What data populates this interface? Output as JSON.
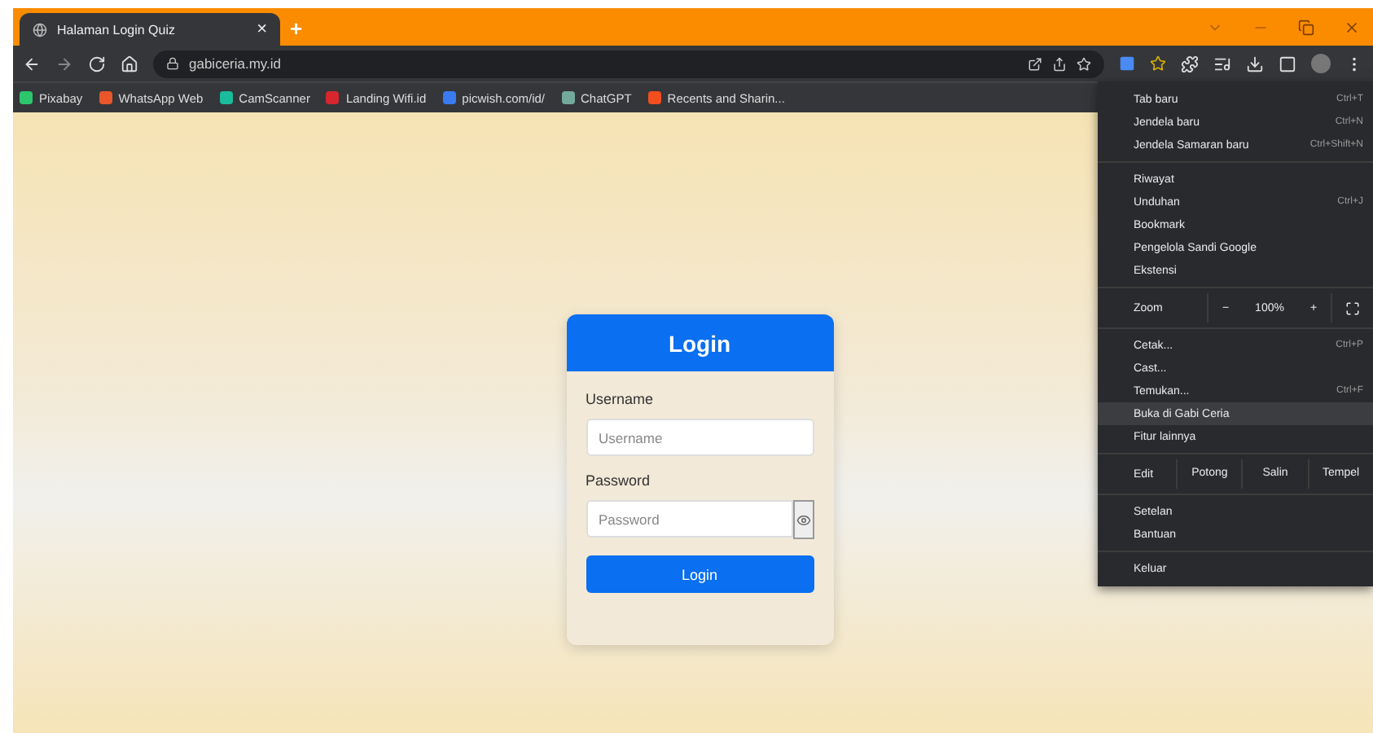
{
  "browser": {
    "tabs": [
      {
        "title": "Halaman Login Quiz",
        "close": "×",
        "selected": true
      }
    ],
    "new_tab": "+",
    "address": "gabiceria.my.id",
    "bookmarks": [
      {
        "label": "Pixabay",
        "color": "#2ec66d"
      },
      {
        "label": "WhatsApp Web",
        "color": "#e8562a"
      },
      {
        "label": "CamScanner",
        "color": "#19bc9c"
      },
      {
        "label": "Landing Wifi.id",
        "color": "#d8262e"
      },
      {
        "label": "picwish.com/id/",
        "color": "#3a7bf0"
      },
      {
        "label": "ChatGPT",
        "color": "#74aa9c"
      },
      {
        "label": "Recents and Sharin...",
        "color": "#f24e1e"
      }
    ]
  },
  "menu": {
    "items": [
      {
        "kind": "item",
        "label": "Tab baru",
        "shortcut": "Ctrl+T",
        "selected": false
      },
      {
        "kind": "item",
        "label": "Jendela baru",
        "shortcut": "Ctrl+N",
        "selected": false
      },
      {
        "kind": "item",
        "label": "Jendela Samaran baru",
        "shortcut": "Ctrl+Shift+N",
        "selected": false
      },
      {
        "kind": "divider"
      },
      {
        "kind": "item",
        "label": "Riwayat",
        "selected": false
      },
      {
        "kind": "item",
        "label": "Unduhan",
        "shortcut": "Ctrl+J",
        "selected": false
      },
      {
        "kind": "item",
        "label": "Bookmark",
        "selected": false
      },
      {
        "kind": "item",
        "label": "Pengelola Sandi Google",
        "selected": false
      },
      {
        "kind": "item",
        "label": "Ekstensi",
        "selected": false
      },
      {
        "kind": "divider"
      },
      {
        "kind": "zoom",
        "label": "Zoom",
        "minus": "−",
        "value": "100%",
        "plus": "+"
      },
      {
        "kind": "divider"
      },
      {
        "kind": "item",
        "label": "Cetak...",
        "shortcut": "Ctrl+P",
        "selected": false
      },
      {
        "kind": "item",
        "label": "Cast...",
        "selected": false
      },
      {
        "kind": "item",
        "label": "Temukan...",
        "shortcut": "Ctrl+F",
        "selected": false
      },
      {
        "kind": "item",
        "label": "Buka di Gabi Ceria",
        "selected": true
      },
      {
        "kind": "item",
        "label": "Fitur lainnya",
        "selected": false
      },
      {
        "kind": "divider"
      },
      {
        "kind": "edit",
        "label": "Edit",
        "actions": [
          "Potong",
          "Salin",
          "Tempel"
        ]
      },
      {
        "kind": "divider"
      },
      {
        "kind": "item",
        "label": "Setelan",
        "selected": false
      },
      {
        "kind": "item",
        "label": "Bantuan",
        "selected": false
      },
      {
        "kind": "divider"
      },
      {
        "kind": "item",
        "label": "Keluar",
        "selected": false
      }
    ]
  },
  "login": {
    "title": "Login",
    "username_label": "Username",
    "username_placeholder": "Username",
    "password_label": "Password",
    "password_placeholder": "Password",
    "button": "Login"
  }
}
